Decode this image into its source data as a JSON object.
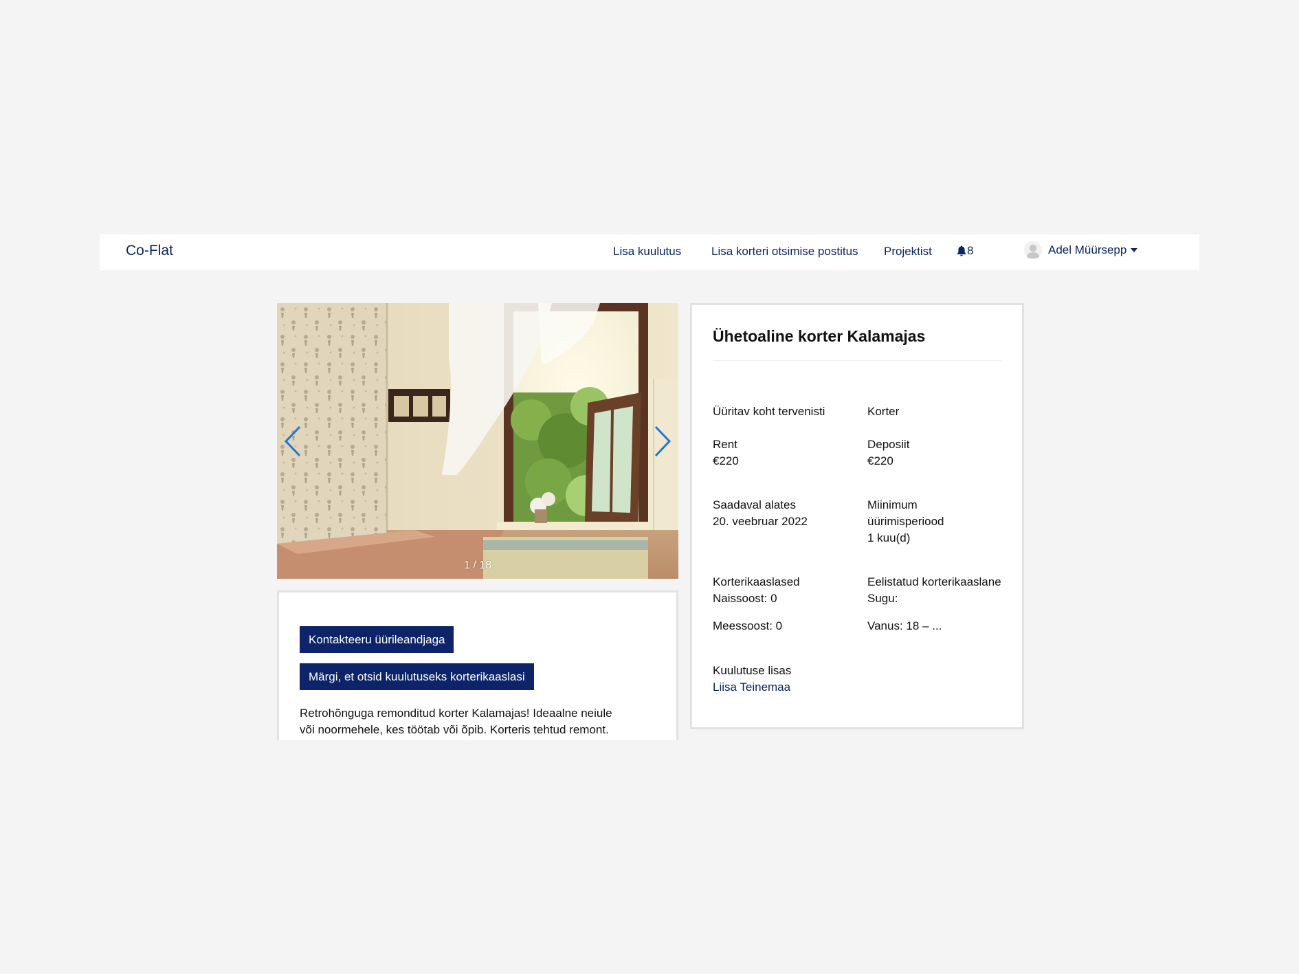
{
  "navbar": {
    "brand": "Co-Flat",
    "links": {
      "add_listing": "Lisa kuulutus",
      "add_search_post": "Lisa korteri otsimise postitus",
      "project": "Projektist"
    },
    "notifications": {
      "icon": "bell-icon",
      "count": "8"
    },
    "user": {
      "name": "Adel Müürsepp",
      "icon": "avatar-icon"
    }
  },
  "gallery": {
    "counter": "1 / 18",
    "prev_icon": "chevron-left-icon",
    "next_icon": "chevron-right-icon"
  },
  "actions": {
    "contact_button": "Kontakteeru üürileandjaga",
    "mark_button": "Märgi, et otsid kuulutuseks korterikaaslasi",
    "description": "Retrohõnguga remonditud korter Kalamajas! Ideaalne neiule või noormehele, kes töötab või õpib. Korteris tehtud remont."
  },
  "listing": {
    "title": "Ühetoaline korter Kalamajas",
    "rental_type": "Üüritav koht tervenisti",
    "property_type": "Korter",
    "rent_label": "Rent",
    "rent_value": "€220",
    "deposit_label": "Deposiit",
    "deposit_value": "€220",
    "available_label": "Saadaval alates",
    "available_value": "20. veebruar 2022",
    "min_period_label": "Miinimum üürimisperiood",
    "min_period_value": "1 kuu(d)",
    "flatmates_label": "Korterikaaslased",
    "flatmates_female": "Naissoost: 0",
    "flatmates_male": "Meessoost: 0",
    "preferred_label": "Eelistatud korterikaaslane",
    "preferred_gender": "Sugu:",
    "preferred_age": "Vanus: 18 – ...",
    "added_by_label": "Kuulutuse lisas",
    "added_by_name": "Liisa Teinemaa"
  },
  "colors": {
    "brand_navy": "#0d2468",
    "link_navy": "#0b2566",
    "page_bg": "#f4f4f4",
    "arrow_blue": "#1e78d7"
  }
}
